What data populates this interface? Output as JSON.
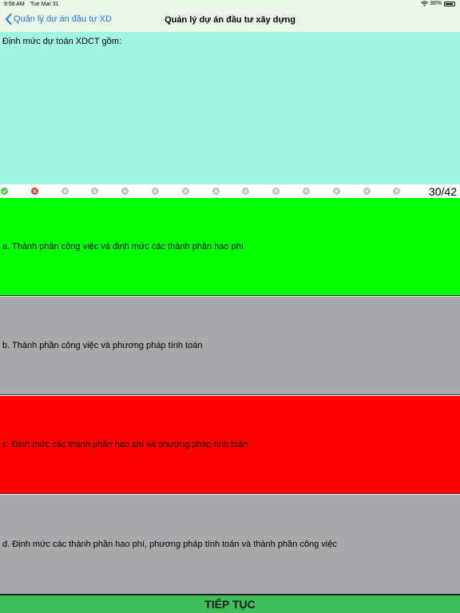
{
  "status_bar": {
    "time": "9:58 AM",
    "date": "Tue Mar 31",
    "battery": "86%",
    "battery_level": 0.86,
    "wifi_icon": "wifi-icon",
    "battery_icon": "battery-icon"
  },
  "nav": {
    "back_label": "Quản lý dự án đầu tư XD",
    "title": "Quản lý dự án đầu tư xây dựng",
    "back_icon": "chevron-left-icon"
  },
  "question": {
    "text": "Định mức dự toán XDCT gồm:"
  },
  "progress": {
    "counter": "30/42",
    "dots": [
      "correct",
      "wrong",
      "unanswered",
      "unanswered",
      "unanswered",
      "unanswered",
      "unanswered",
      "unanswered",
      "unanswered",
      "unanswered",
      "unanswered",
      "unanswered",
      "unanswered",
      "unanswered"
    ]
  },
  "answers": [
    {
      "text": "a. Thành phần công việc và định mức các thành phần hao phí",
      "state": "correct",
      "color": "#00ff00"
    },
    {
      "text": "b. Thành phần công việc và phương pháp tính toán",
      "state": "neutral",
      "color": "#a9a8aa"
    },
    {
      "text": "c. Định mức các thành phần hao phí và phương pháp tính toán",
      "state": "wrong",
      "color": "#ff0000"
    },
    {
      "text": "d. Định mức các thành phần hao phí, phương pháp tính toán và thành phần công việc",
      "state": "neutral",
      "color": "#a9a8aa"
    }
  ],
  "next_button": {
    "label": "TIẾP TỤC"
  },
  "colors": {
    "accent": "#1d74e8",
    "question_bg": "#9ff6df",
    "header_bg": "#eaf7e9",
    "correct": "#00ff00",
    "wrong": "#ff0000",
    "neutral": "#a9a8aa",
    "next_button": "#3fbf5a",
    "dot_correct": "#45c84a",
    "dot_wrong": "#e53935",
    "dot_unanswered": "#bdbdbd"
  }
}
